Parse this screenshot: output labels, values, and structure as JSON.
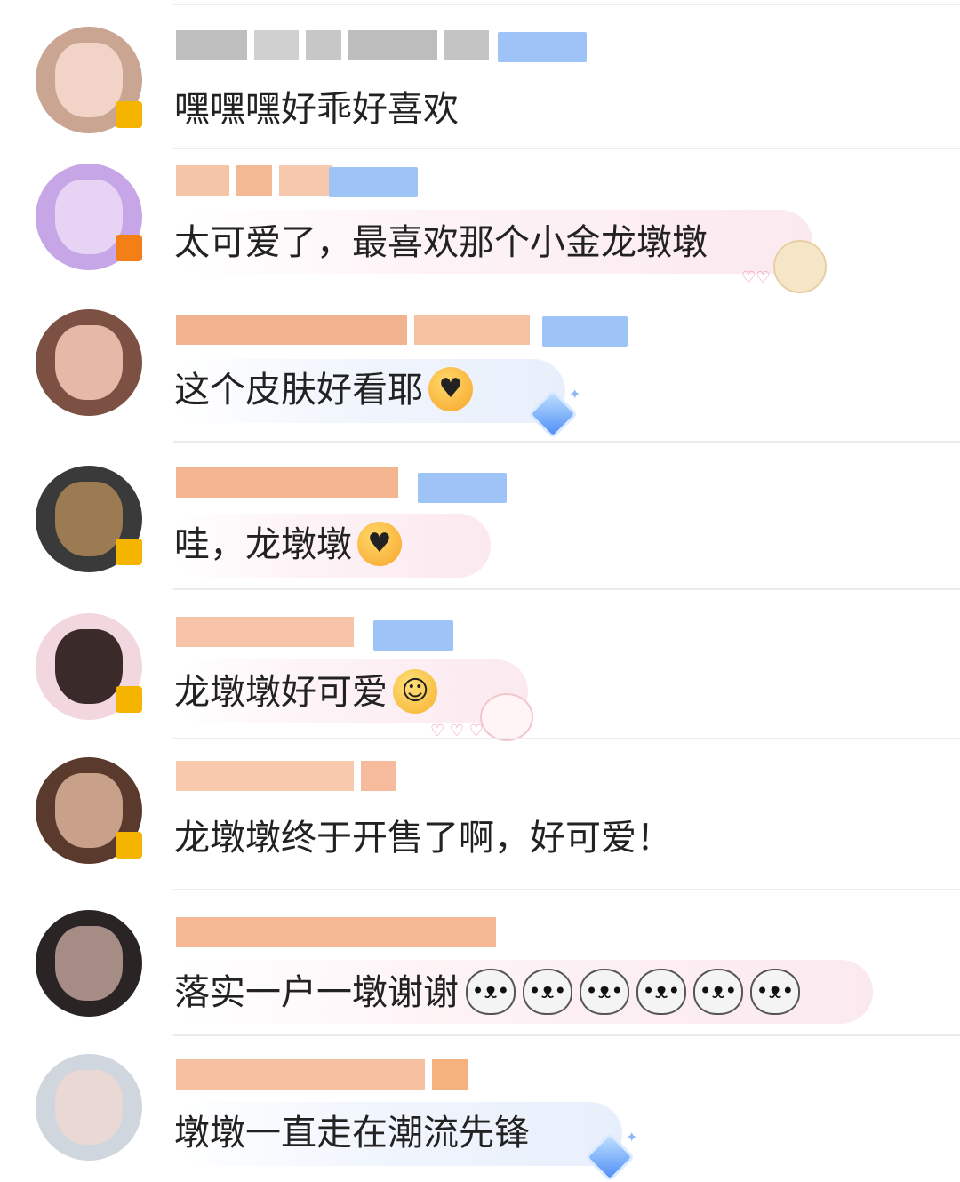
{
  "comments": [
    {
      "name": "",
      "text": "嘿嘿嘿好乖好喜欢"
    },
    {
      "name": "",
      "text": "太可爱了，最喜欢那个小金龙墩墩"
    },
    {
      "name": "",
      "text": "这个皮肤好看耶"
    },
    {
      "name": "",
      "text": "哇，龙墩墩"
    },
    {
      "name": "",
      "text": "龙墩墩好可爱"
    },
    {
      "name": "",
      "text": "龙墩墩终于开售了啊，好可爱！"
    },
    {
      "name": "",
      "text": "落实一户一墩谢谢"
    },
    {
      "name": "",
      "text": "墩墩一直走在潮流先锋"
    }
  ],
  "icons": {
    "heart_eyes": "heart-eyes-emoji-icon",
    "hug": "hugging-face-emoji-icon",
    "excited": "excited-face-emoji-icon",
    "panda": "panda-emoji-icon",
    "hamster": "hamster-sticker-icon",
    "sheep": "sheep-sticker-icon",
    "gem": "blue-gem-icon"
  },
  "colors": {
    "text": "#222222",
    "divider": "#ececec",
    "vip_badge": "#f5b400",
    "level_badge": "#9ec3f7",
    "bubble_pink": "#fbe9ef",
    "bubble_blue": "#e8effc"
  }
}
